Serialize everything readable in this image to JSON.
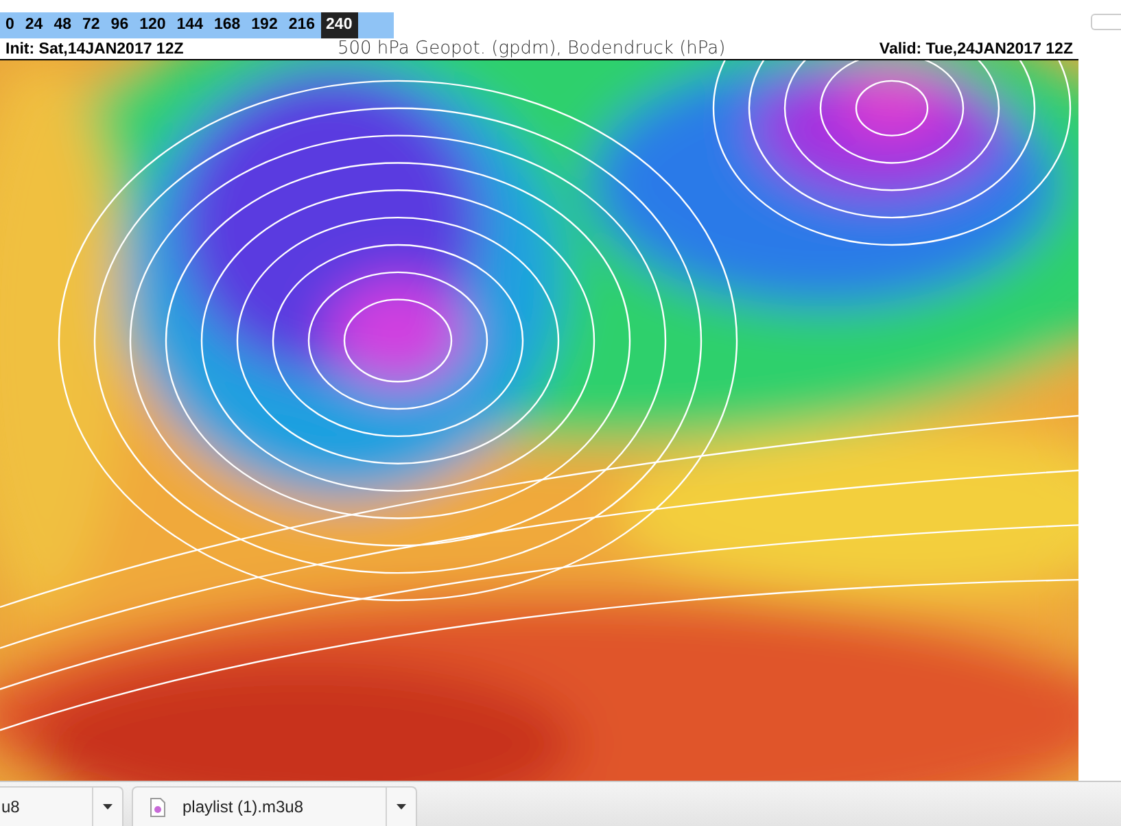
{
  "forecast_hours": [
    {
      "label": "0",
      "selected": false
    },
    {
      "label": "24",
      "selected": false
    },
    {
      "label": "48",
      "selected": false
    },
    {
      "label": "72",
      "selected": false
    },
    {
      "label": "96",
      "selected": false
    },
    {
      "label": "120",
      "selected": false
    },
    {
      "label": "144",
      "selected": false
    },
    {
      "label": "168",
      "selected": false
    },
    {
      "label": "192",
      "selected": false
    },
    {
      "label": "216",
      "selected": false
    },
    {
      "label": "240",
      "selected": true
    }
  ],
  "header": {
    "init": "Init: Sat,14JAN2017 12Z",
    "title": "500 hPa Geopot. (gpdm), Bodendruck (hPa)",
    "valid": "Valid: Tue,24JAN2017 12Z"
  },
  "downloads": [
    {
      "name": "u8"
    },
    {
      "name": "playlist (1).m3u8"
    }
  ]
}
